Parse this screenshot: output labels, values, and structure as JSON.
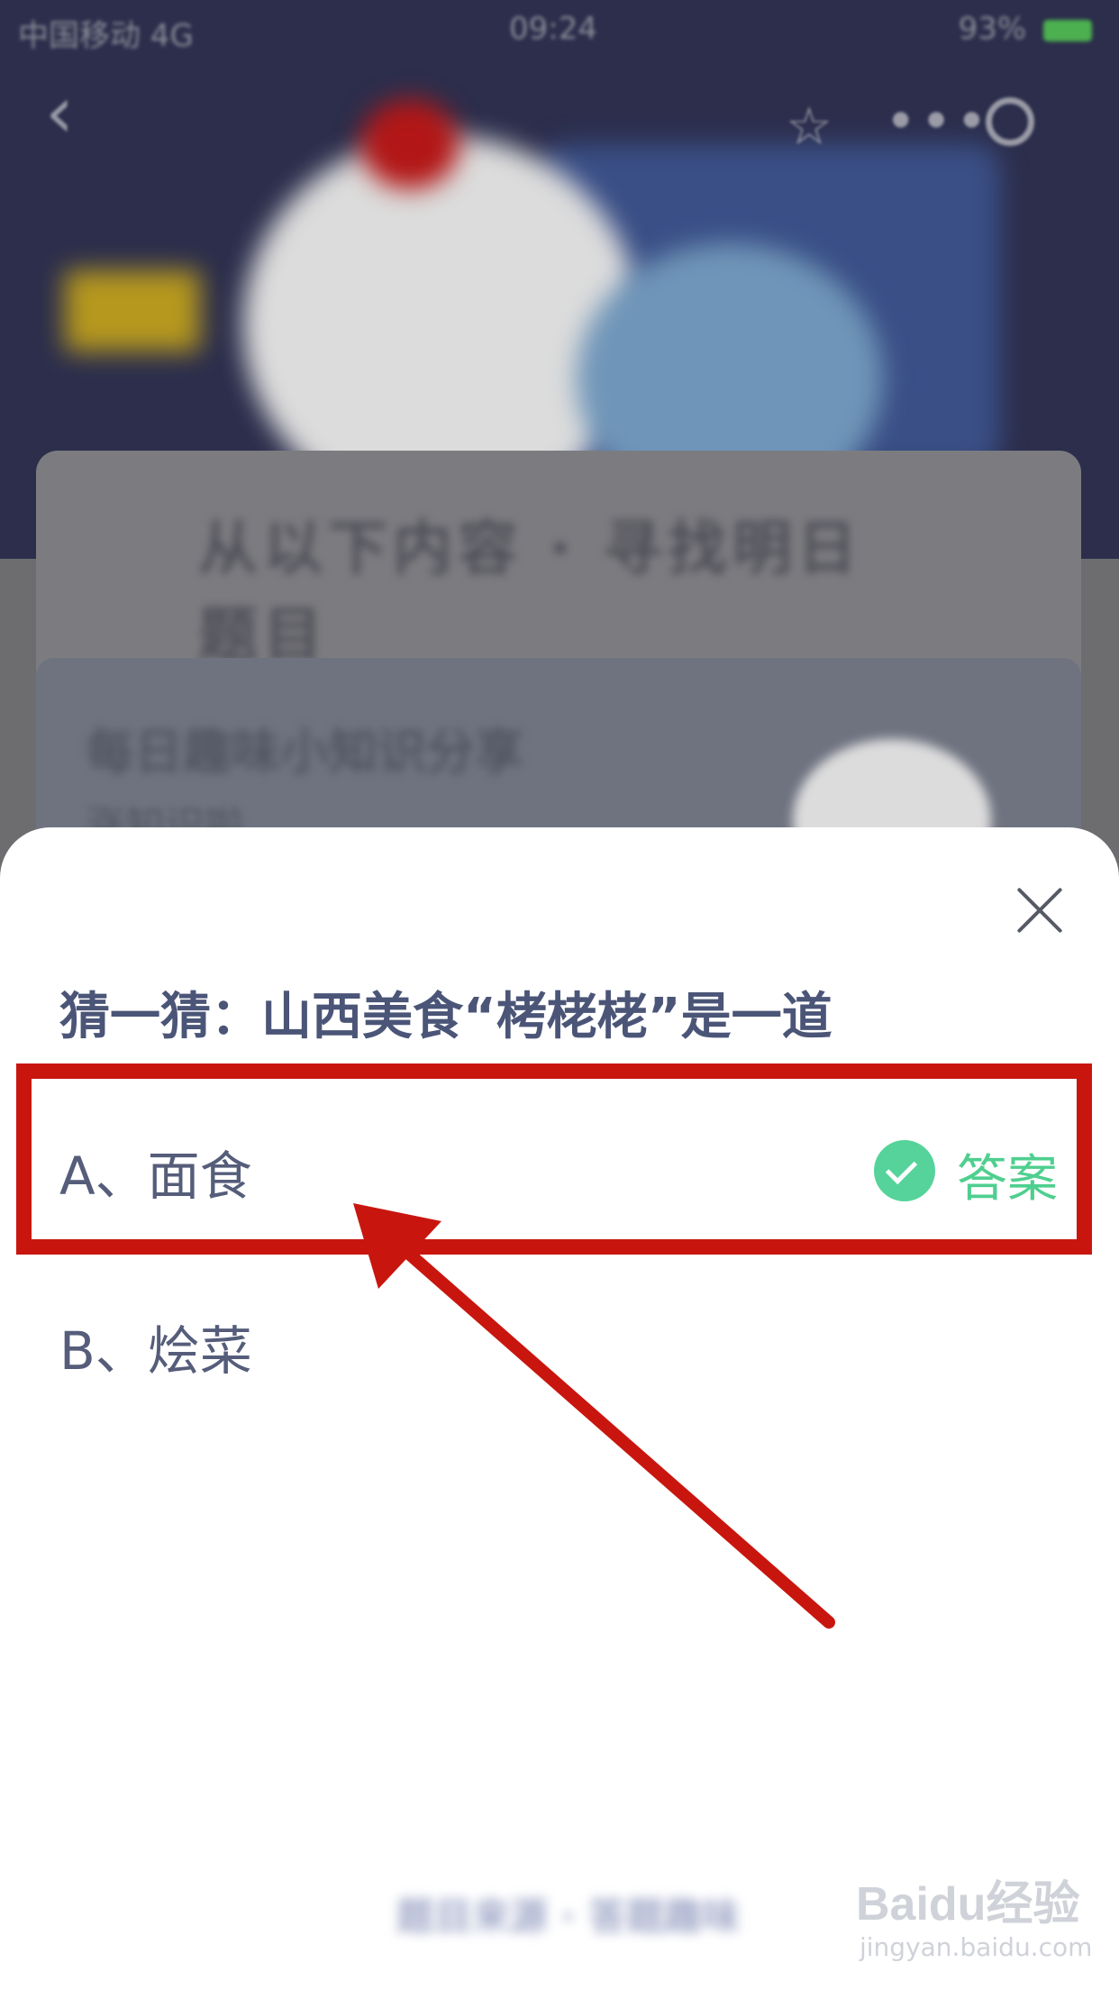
{
  "status_bar": {
    "carrier": "中国移动 4G",
    "time": "09:24",
    "battery": "93%"
  },
  "background": {
    "heading": "从以下内容 · 寻找明日题目",
    "card_title": "每日趣味小知识分享",
    "card_subtitle": "涨知识啦"
  },
  "sheet": {
    "question": "猜一猜：山西美食“栲栳栳”是一道",
    "options": [
      {
        "label": "A、面食",
        "is_answer": true
      },
      {
        "label": "B、烩菜",
        "is_answer": false
      }
    ],
    "answer_label": "答案",
    "footer": "题目来源 · 答题趣味"
  },
  "colors": {
    "highlight": "#c8160f",
    "answer_green": "#4fcf8f",
    "question_text": "#4b5577"
  },
  "watermark": {
    "logo": "Baidu经验",
    "url": "jingyan.baidu.com"
  }
}
